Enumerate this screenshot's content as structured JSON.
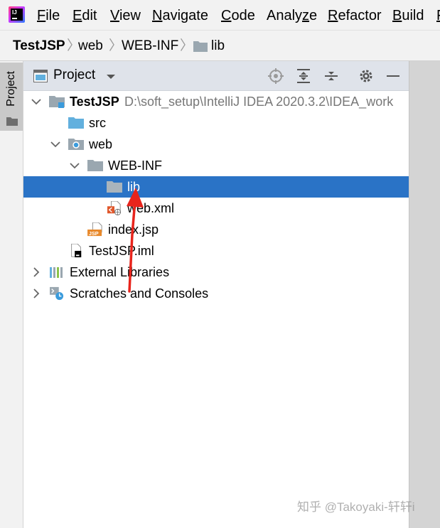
{
  "menubar": {
    "items": [
      {
        "mnemonic": "F",
        "rest": "ile"
      },
      {
        "mnemonic": "E",
        "rest": "dit"
      },
      {
        "mnemonic": "V",
        "rest": "iew"
      },
      {
        "mnemonic": "N",
        "rest": "avigate"
      },
      {
        "mnemonic": "C",
        "rest": "ode"
      },
      {
        "pre": "Analy",
        "mnemonic": "z",
        "rest": "e"
      },
      {
        "mnemonic": "R",
        "rest": "efactor"
      },
      {
        "mnemonic": "B",
        "rest": "uild"
      },
      {
        "mnemonic": "F",
        "rest": ""
      }
    ]
  },
  "breadcrumb": {
    "items": [
      "TestJSP",
      "web",
      "WEB-INF",
      "lib"
    ]
  },
  "left_strip": {
    "tab_label": "Project"
  },
  "panel": {
    "title": "Project",
    "actions": [
      "locate-icon",
      "expand-all-icon",
      "collapse-all-icon",
      "gear-icon",
      "minimize-icon"
    ]
  },
  "tree": {
    "root": {
      "label": "TestJSP",
      "path": "D:\\soft_setup\\IntelliJ IDEA 2020.3.2\\IDEA_work"
    },
    "src": "src",
    "web": "web",
    "web_inf": "WEB-INF",
    "lib": "lib",
    "web_xml": "web.xml",
    "index_jsp": "index.jsp",
    "testjsp_iml": "TestJSP.iml",
    "external_libraries": "External Libraries",
    "scratches": "Scratches and Consoles",
    "selected": "lib"
  },
  "watermark": "知乎 @Takoyaki-轩轩i",
  "colors": {
    "selection": "#2a73c6",
    "annotation_arrow": "#e8241c",
    "folder_gray": "#9aa7b0",
    "folder_blue": "#62b0de"
  }
}
